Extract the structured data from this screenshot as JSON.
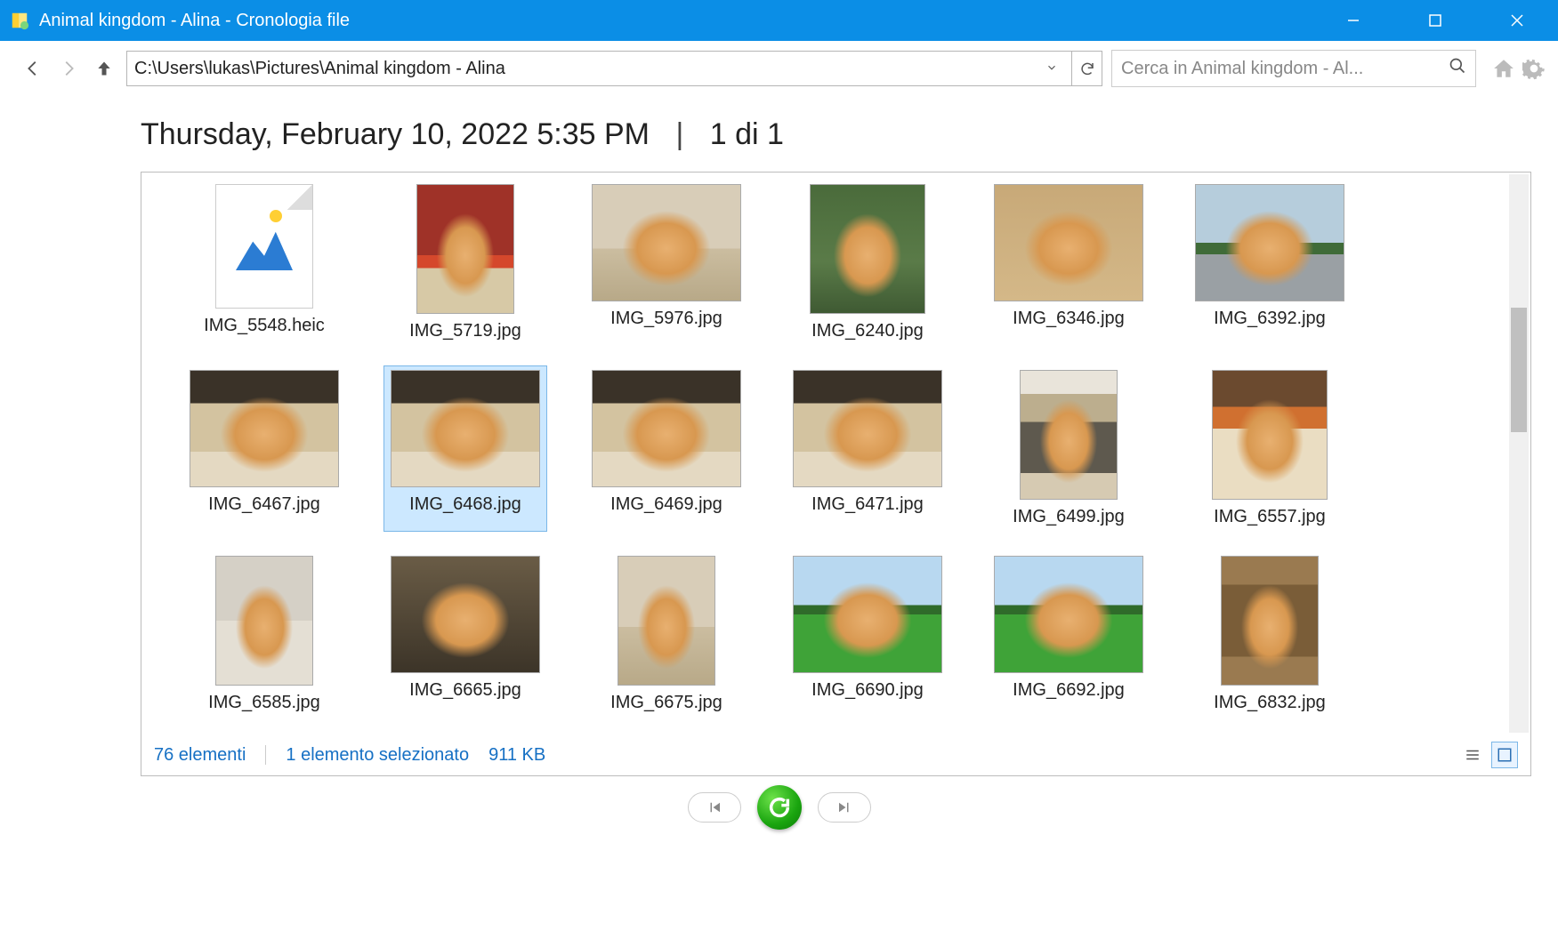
{
  "window": {
    "title": "Animal kingdom - Alina - Cronologia file"
  },
  "toolbar": {
    "path": "C:\\Users\\lukas\\Pictures\\Animal kingdom - Alina",
    "search_placeholder": "Cerca in Animal kingdom - Al..."
  },
  "heading": {
    "timestamp": "Thursday, February 10, 2022 5:35 PM",
    "separator": "|",
    "position": "1 di 1"
  },
  "files": [
    {
      "name": "IMG_5548.heic",
      "thumb": "file",
      "shape": "file",
      "selected": false
    },
    {
      "name": "IMG_5719.jpg",
      "thumb": "bg-red",
      "shape": "tall",
      "selected": false
    },
    {
      "name": "IMG_5976.jpg",
      "thumb": "bg-floor",
      "shape": "wide",
      "selected": false
    },
    {
      "name": "IMG_6240.jpg",
      "thumb": "bg-green",
      "shape": "tall2",
      "selected": false
    },
    {
      "name": "IMG_6346.jpg",
      "thumb": "bg-wood",
      "shape": "wide",
      "selected": false
    },
    {
      "name": "IMG_6392.jpg",
      "thumb": "bg-road",
      "shape": "wide",
      "selected": false
    },
    {
      "name": "IMG_6467.jpg",
      "thumb": "bg-bed",
      "shape": "wide",
      "selected": false
    },
    {
      "name": "IMG_6468.jpg",
      "thumb": "bg-bed",
      "shape": "wide",
      "selected": true
    },
    {
      "name": "IMG_6469.jpg",
      "thumb": "bg-bed",
      "shape": "wide",
      "selected": false
    },
    {
      "name": "IMG_6471.jpg",
      "thumb": "bg-bed",
      "shape": "wide",
      "selected": false
    },
    {
      "name": "IMG_6499.jpg",
      "thumb": "bg-chair",
      "shape": "tall",
      "selected": false
    },
    {
      "name": "IMG_6557.jpg",
      "thumb": "bg-kitch",
      "shape": "tall2",
      "selected": false
    },
    {
      "name": "IMG_6585.jpg",
      "thumb": "bg-box",
      "shape": "tall",
      "selected": false
    },
    {
      "name": "IMG_6665.jpg",
      "thumb": "bg-dark",
      "shape": "wide",
      "selected": false
    },
    {
      "name": "IMG_6675.jpg",
      "thumb": "bg-floor",
      "shape": "tall",
      "selected": false
    },
    {
      "name": "IMG_6690.jpg",
      "thumb": "bg-grass",
      "shape": "wide",
      "selected": false
    },
    {
      "name": "IMG_6692.jpg",
      "thumb": "bg-grass",
      "shape": "wide",
      "selected": false
    },
    {
      "name": "IMG_6832.jpg",
      "thumb": "bg-cardb",
      "shape": "tall",
      "selected": false
    }
  ],
  "status": {
    "count": "76 elementi",
    "selection": "1 elemento selezionato",
    "size": "911 KB"
  }
}
